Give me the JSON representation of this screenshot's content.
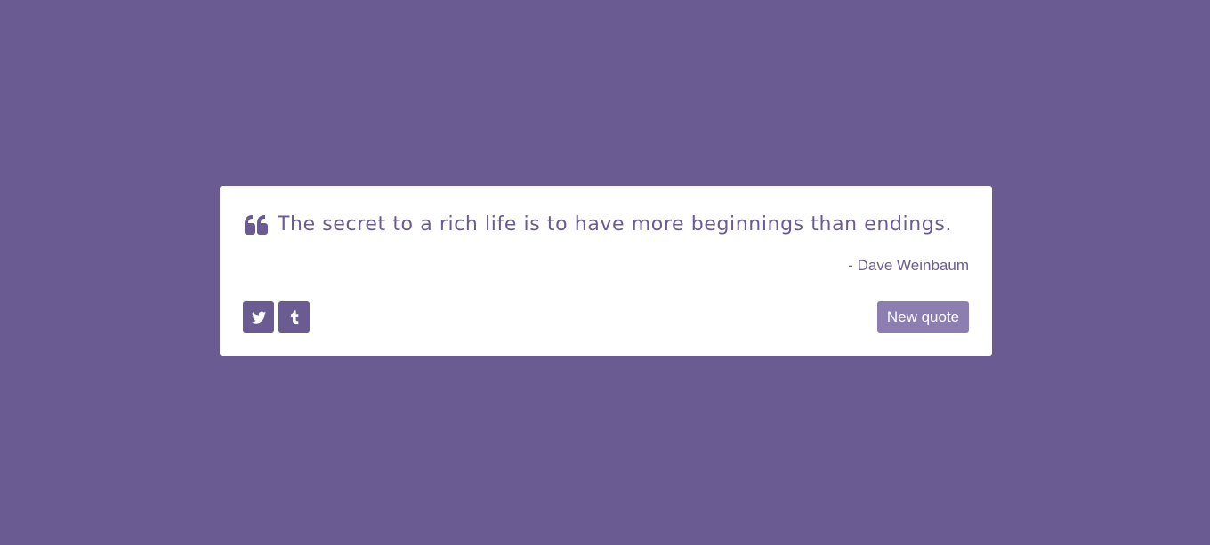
{
  "theme": {
    "background": "#6a5b93",
    "card": "#ffffff",
    "accent": "#6a5b93",
    "button": "#8c7eb0",
    "button_text": "#ffffff"
  },
  "quote": {
    "icon": "quote-left-icon",
    "text": "The secret to a rich life is to have more beginnings than endings.",
    "author": "- Dave Weinbaum"
  },
  "actions": {
    "social": [
      {
        "icon": "twitter-icon"
      },
      {
        "icon": "tumblr-icon"
      }
    ],
    "new_quote_label": "New quote"
  }
}
